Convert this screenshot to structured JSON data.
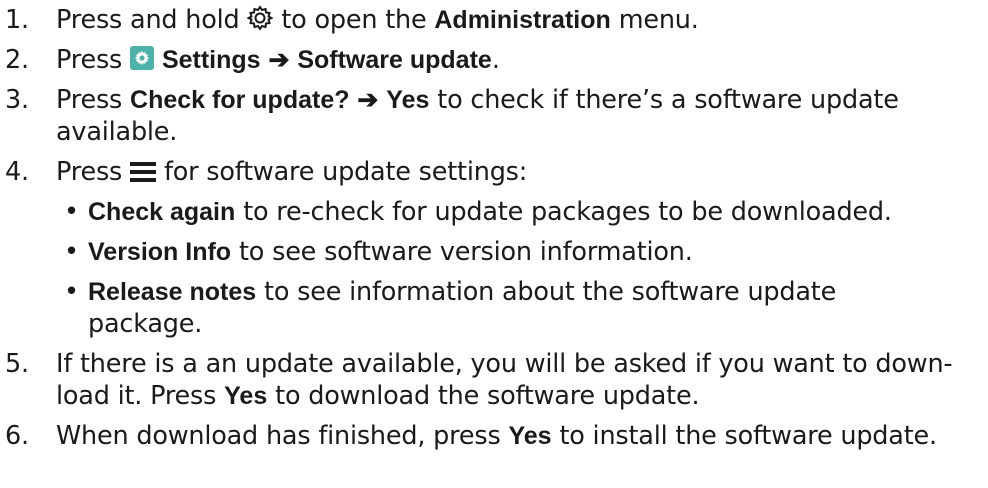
{
  "steps": [
    {
      "num": "1.",
      "pre": "Press and hold",
      "icon": "gear-icon",
      "mid": "to open the",
      "bold": "Administration",
      "post": "menu."
    },
    {
      "num": "2.",
      "pre": "Press",
      "icon": "settings-icon",
      "bold1": "Settings",
      "arrow": "➔",
      "bold2": "Software update",
      "post": "."
    },
    {
      "num": "3.",
      "pre": "Press",
      "bold1": "Check for update?",
      "arrow": "➔",
      "bold2": "Yes",
      "post": "to check if there’s a software update",
      "cont": "available."
    },
    {
      "num": "4.",
      "pre": "Press",
      "icon": "menu-icon",
      "post": "for software update settings:",
      "bullets": [
        {
          "bold": "Check again",
          "text": "to re-check for update packages to be downloaded."
        },
        {
          "bold": "Version Info",
          "text": "to see software version information."
        },
        {
          "bold": "Release notes",
          "text": "to see information about the software update",
          "cont": "package."
        }
      ]
    },
    {
      "num": "5.",
      "line1": "If there is a an update available, you will be asked if you want to down-",
      "pre2": "load it. Press",
      "bold": "Yes",
      "post2": "to download the software update."
    },
    {
      "num": "6.",
      "pre": "When download has finished, press",
      "bold": "Yes",
      "post": "to install the software update."
    }
  ],
  "bullet_glyph": "•"
}
